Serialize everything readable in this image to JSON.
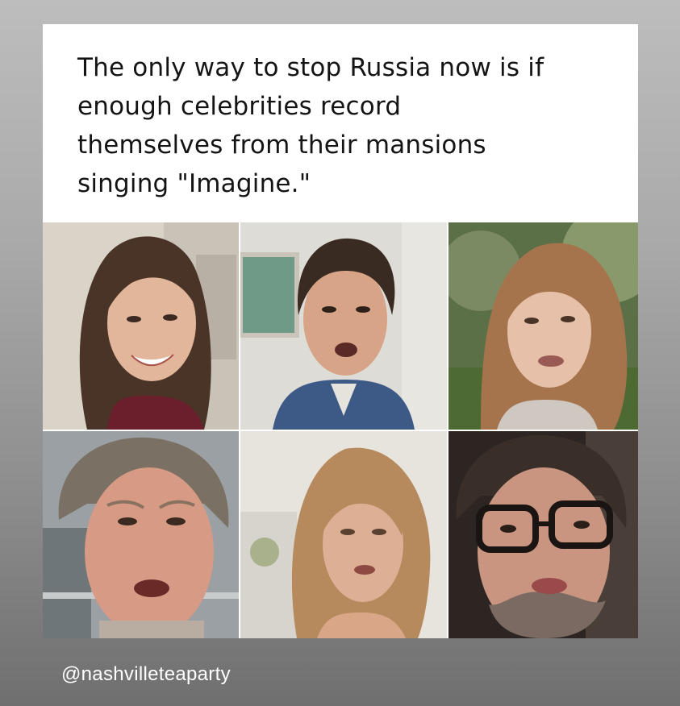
{
  "post": {
    "caption_lines": [
      "The only way to stop Russia now is if",
      "enough celebrities record",
      "themselves from their mansions",
      "singing \"Imagine.\""
    ],
    "handle": "@nashvilleteaparty"
  },
  "photos": [
    {
      "name": "photo-woman-smiling"
    },
    {
      "name": "photo-man-singing"
    },
    {
      "name": "photo-woman-outdoors"
    },
    {
      "name": "photo-man-closeup"
    },
    {
      "name": "photo-woman-blonde"
    },
    {
      "name": "photo-man-glasses"
    }
  ]
}
